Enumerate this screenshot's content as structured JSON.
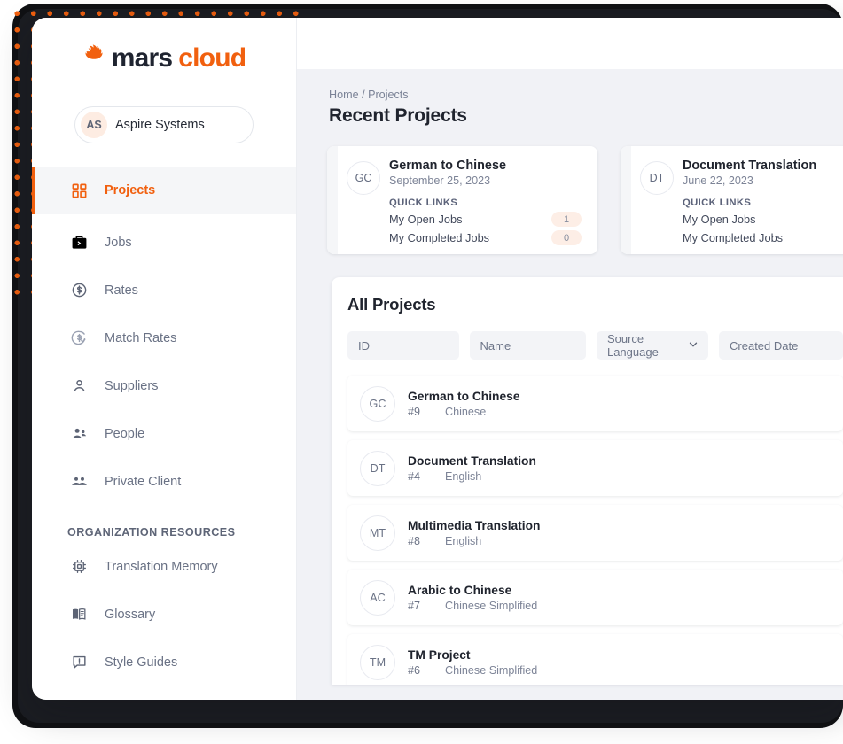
{
  "brand": {
    "name_dark": "mars",
    "name_accent": "cloud",
    "accent_color": "#f1600f",
    "flame_icon": "flame-icon"
  },
  "sidebar": {
    "org_selector": {
      "initials": "AS",
      "name": "Aspire Systems",
      "chevron_icon": "chevron-down-icon"
    },
    "items": [
      {
        "label": "Projects",
        "icon": "grid-icon",
        "active": true
      },
      {
        "label": "Jobs",
        "icon": "briefcase-icon",
        "active": false
      },
      {
        "label": "Rates",
        "icon": "dollar-circle-icon",
        "active": false
      },
      {
        "label": "Match Rates",
        "icon": "dollar-check-icon",
        "active": false
      },
      {
        "label": "Suppliers",
        "icon": "person-icon",
        "active": false
      },
      {
        "label": "People",
        "icon": "people-icon",
        "active": false
      },
      {
        "label": "Private Client",
        "icon": "group-icon",
        "active": false
      }
    ],
    "section_title": "ORGANIZATION RESOURCES",
    "resource_items": [
      {
        "label": "Translation Memory",
        "icon": "chip-icon"
      },
      {
        "label": "Glossary",
        "icon": "book-icon"
      },
      {
        "label": "Style Guides",
        "icon": "speech-alert-icon"
      }
    ]
  },
  "header": {
    "breadcrumb": "Home / Projects",
    "title": "Recent Projects"
  },
  "recent_cards": [
    {
      "initials": "GC",
      "title": "German to Chinese",
      "date": "September 25, 2023",
      "quick_links_label": "QUICK LINKS",
      "links": [
        {
          "label": "My Open Jobs",
          "count": "1"
        },
        {
          "label": "My Completed Jobs",
          "count": "0"
        }
      ]
    },
    {
      "initials": "DT",
      "title": "Document Translation",
      "date": "June 22, 2023",
      "quick_links_label": "QUICK LINKS",
      "links": [
        {
          "label": "My Open Jobs",
          "count": ""
        },
        {
          "label": "My Completed Jobs",
          "count": ""
        }
      ]
    }
  ],
  "all_projects": {
    "title": "All Projects",
    "filters": [
      {
        "name": "id-filter",
        "placeholder": "ID"
      },
      {
        "name": "name-filter",
        "placeholder": "Name"
      },
      {
        "name": "source-language-filter",
        "placeholder": "Source Language",
        "icon": "chevron-down-icon"
      },
      {
        "name": "created-date-filter",
        "placeholder": "Created Date"
      }
    ],
    "rows": [
      {
        "initials": "GC",
        "name": "German to Chinese",
        "id": "#9",
        "language": "Chinese"
      },
      {
        "initials": "DT",
        "name": "Document Translation",
        "id": "#4",
        "language": "English"
      },
      {
        "initials": "MT",
        "name": "Multimedia Translation",
        "id": "#8",
        "language": "English"
      },
      {
        "initials": "AC",
        "name": "Arabic to Chinese",
        "id": "#7",
        "language": "Chinese Simplified"
      },
      {
        "initials": "TM",
        "name": "TM Project",
        "id": "#6",
        "language": "Chinese Simplified"
      }
    ]
  }
}
